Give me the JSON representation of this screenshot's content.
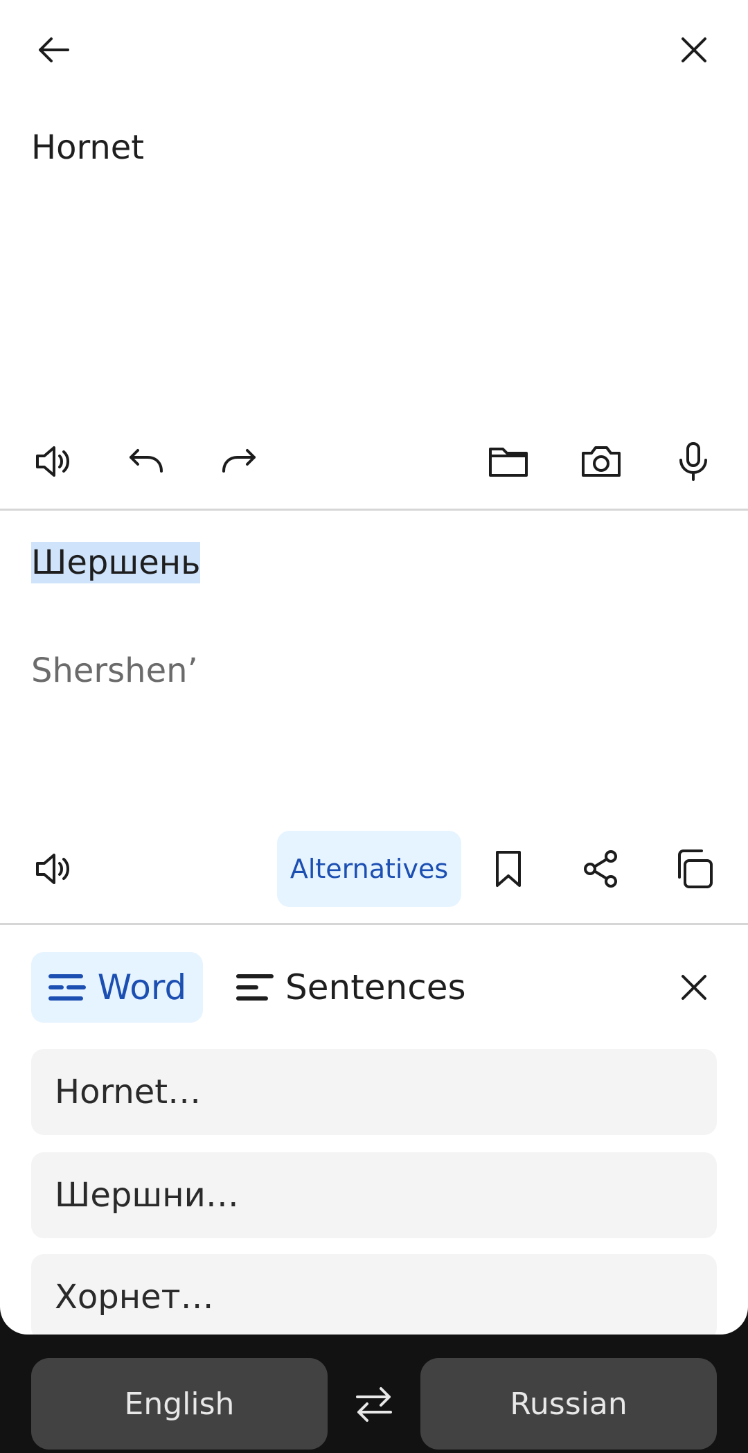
{
  "input": {
    "text": "Hornet"
  },
  "output": {
    "translation": "Шершень",
    "transliteration": "Shershen’",
    "alternatives_label": "Alternatives"
  },
  "panel": {
    "tabs": [
      {
        "label": "Word",
        "selected": true
      },
      {
        "label": "Sentences",
        "selected": false
      }
    ],
    "suggestions": [
      "Hornet…",
      "Шершни…",
      "Хорнет…"
    ]
  },
  "languages": {
    "source": "English",
    "target": "Russian"
  },
  "icons": {
    "top_left": "back-arrow-icon",
    "top_right": "close-icon",
    "input_toolbar": [
      "speaker-icon",
      "undo-icon",
      "redo-icon",
      "folder-icon",
      "camera-icon",
      "microphone-icon"
    ],
    "output_toolbar": [
      "speaker-icon",
      "bookmark-icon",
      "share-icon",
      "copy-icon"
    ],
    "swap": "swap-icon"
  },
  "colors": {
    "accent": "#1c4fb2",
    "accent_bg": "#e6f4ff",
    "highlight": "#cfe4fb"
  }
}
